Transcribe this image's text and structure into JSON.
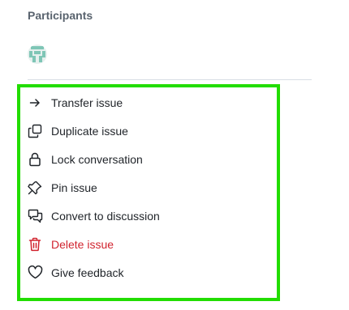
{
  "sidebar": {
    "participants_title": "Participants"
  },
  "menu": {
    "items": [
      {
        "label": "Transfer issue",
        "icon": "arrow-right-icon"
      },
      {
        "label": "Duplicate issue",
        "icon": "copy-icon"
      },
      {
        "label": "Lock conversation",
        "icon": "lock-icon"
      },
      {
        "label": "Pin issue",
        "icon": "pin-icon"
      },
      {
        "label": "Convert to discussion",
        "icon": "comment-discussion-icon"
      },
      {
        "label": "Delete issue",
        "icon": "trash-icon",
        "color": "#d1242f"
      },
      {
        "label": "Give feedback",
        "icon": "heart-icon"
      }
    ]
  },
  "colors": {
    "highlight_border": "#22dd00",
    "danger": "#d1242f",
    "muted_text": "#59636e"
  }
}
